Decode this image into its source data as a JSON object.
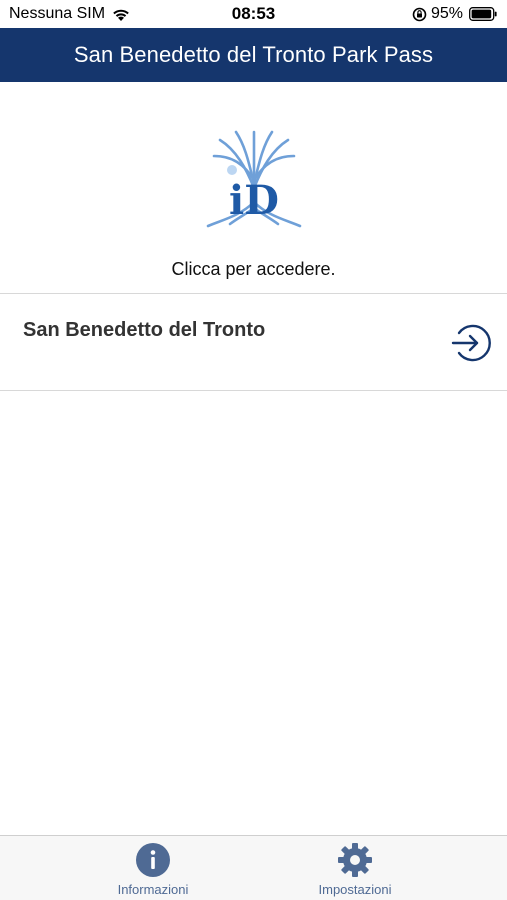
{
  "status_bar": {
    "carrier": "Nessuna SIM",
    "time": "08:53",
    "battery_percent": "95%"
  },
  "nav": {
    "title": "San Benedetto del Tronto Park Pass"
  },
  "login": {
    "logo_text": "iD",
    "hint": "Clicca per accedere."
  },
  "cities": [
    {
      "name": "San Benedetto del Tronto"
    }
  ],
  "tabs": [
    {
      "label": "Informazioni",
      "icon": "info-icon"
    },
    {
      "label": "Impostazioni",
      "icon": "gear-icon"
    }
  ],
  "colors": {
    "nav_background": "#15366d",
    "logo_light_blue": "#6fa0d8",
    "logo_dark_blue": "#1f5aa6",
    "tab_active": "#4f6a94",
    "enter_icon": "#15366d"
  }
}
